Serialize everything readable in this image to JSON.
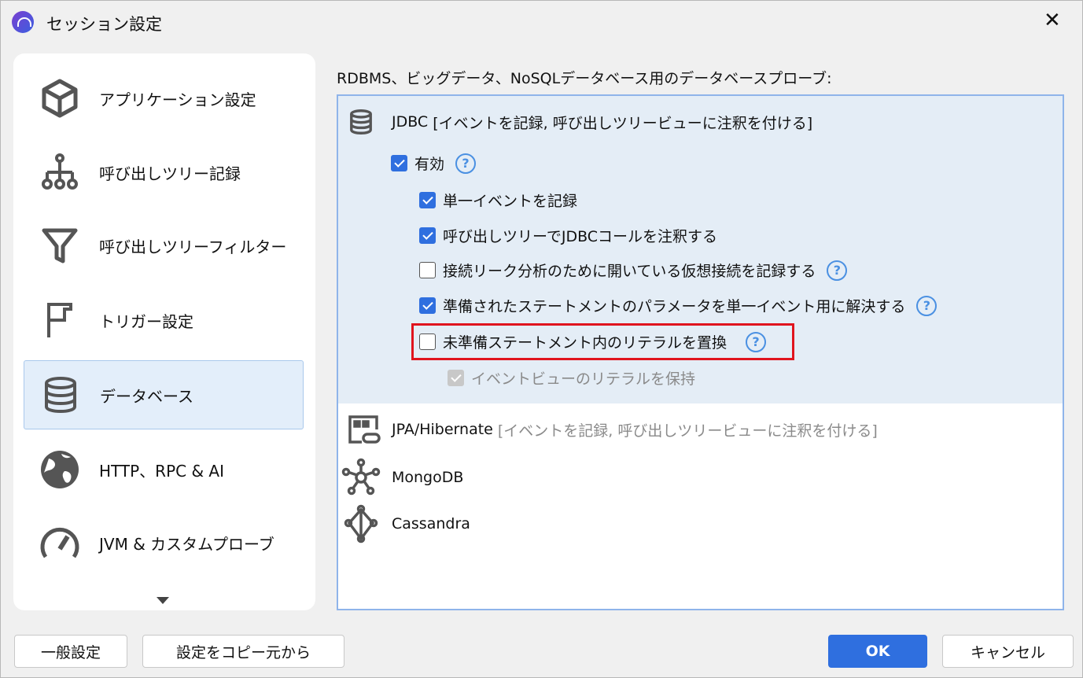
{
  "window": {
    "title": "セッション設定"
  },
  "sidebar": {
    "items": [
      {
        "label": "アプリケーション設定",
        "icon": "cube-icon"
      },
      {
        "label": "呼び出しツリー記録",
        "icon": "tree-icon"
      },
      {
        "label": "呼び出しツリーフィルター",
        "icon": "filter-icon"
      },
      {
        "label": "トリガー設定",
        "icon": "flag-icon"
      },
      {
        "label": "データベース",
        "icon": "database-icon",
        "selected": true
      },
      {
        "label": "HTTP、RPC & AI",
        "icon": "globe-icon"
      },
      {
        "label": "JVM & カスタムプローブ",
        "icon": "gauge-icon"
      }
    ]
  },
  "main": {
    "header": "RDBMS、ビッグデータ、NoSQLデータベース用のデータベースプローブ:",
    "jdbc": {
      "name": "JDBC",
      "tags": "[イベントを記録, 呼び出しツリービューに注釈を付ける]",
      "enabled": {
        "label": "有効",
        "checked": true
      },
      "options": [
        {
          "label": "単一イベントを記録",
          "checked": true,
          "help": false
        },
        {
          "label": "呼び出しツリーでJDBCコールを注釈する",
          "checked": true,
          "help": false
        },
        {
          "label": "接続リーク分析のために開いている仮想接続を記録する",
          "checked": false,
          "help": true
        },
        {
          "label": "準備されたステートメントのパラメータを単一イベント用に解決する",
          "checked": true,
          "help": true
        },
        {
          "label": "未準備ステートメント内のリテラルを置換",
          "checked": false,
          "help": true
        }
      ],
      "sub_option": {
        "label": "イベントビューのリテラルを保持",
        "checked": true,
        "disabled": true
      }
    },
    "probes": [
      {
        "name": "JPA/Hibernate",
        "tags": "[イベントを記録, 呼び出しツリービューに注釈を付ける]"
      },
      {
        "name": "MongoDB",
        "tags": ""
      },
      {
        "name": "Cassandra",
        "tags": ""
      }
    ],
    "help_glyph": "?"
  },
  "footer": {
    "general": "一般設定",
    "copy": "設定をコピー元から",
    "ok": "OK",
    "cancel": "キャンセル"
  },
  "colors": {
    "accent": "#2f6fdf",
    "highlight": "#e0141e"
  }
}
